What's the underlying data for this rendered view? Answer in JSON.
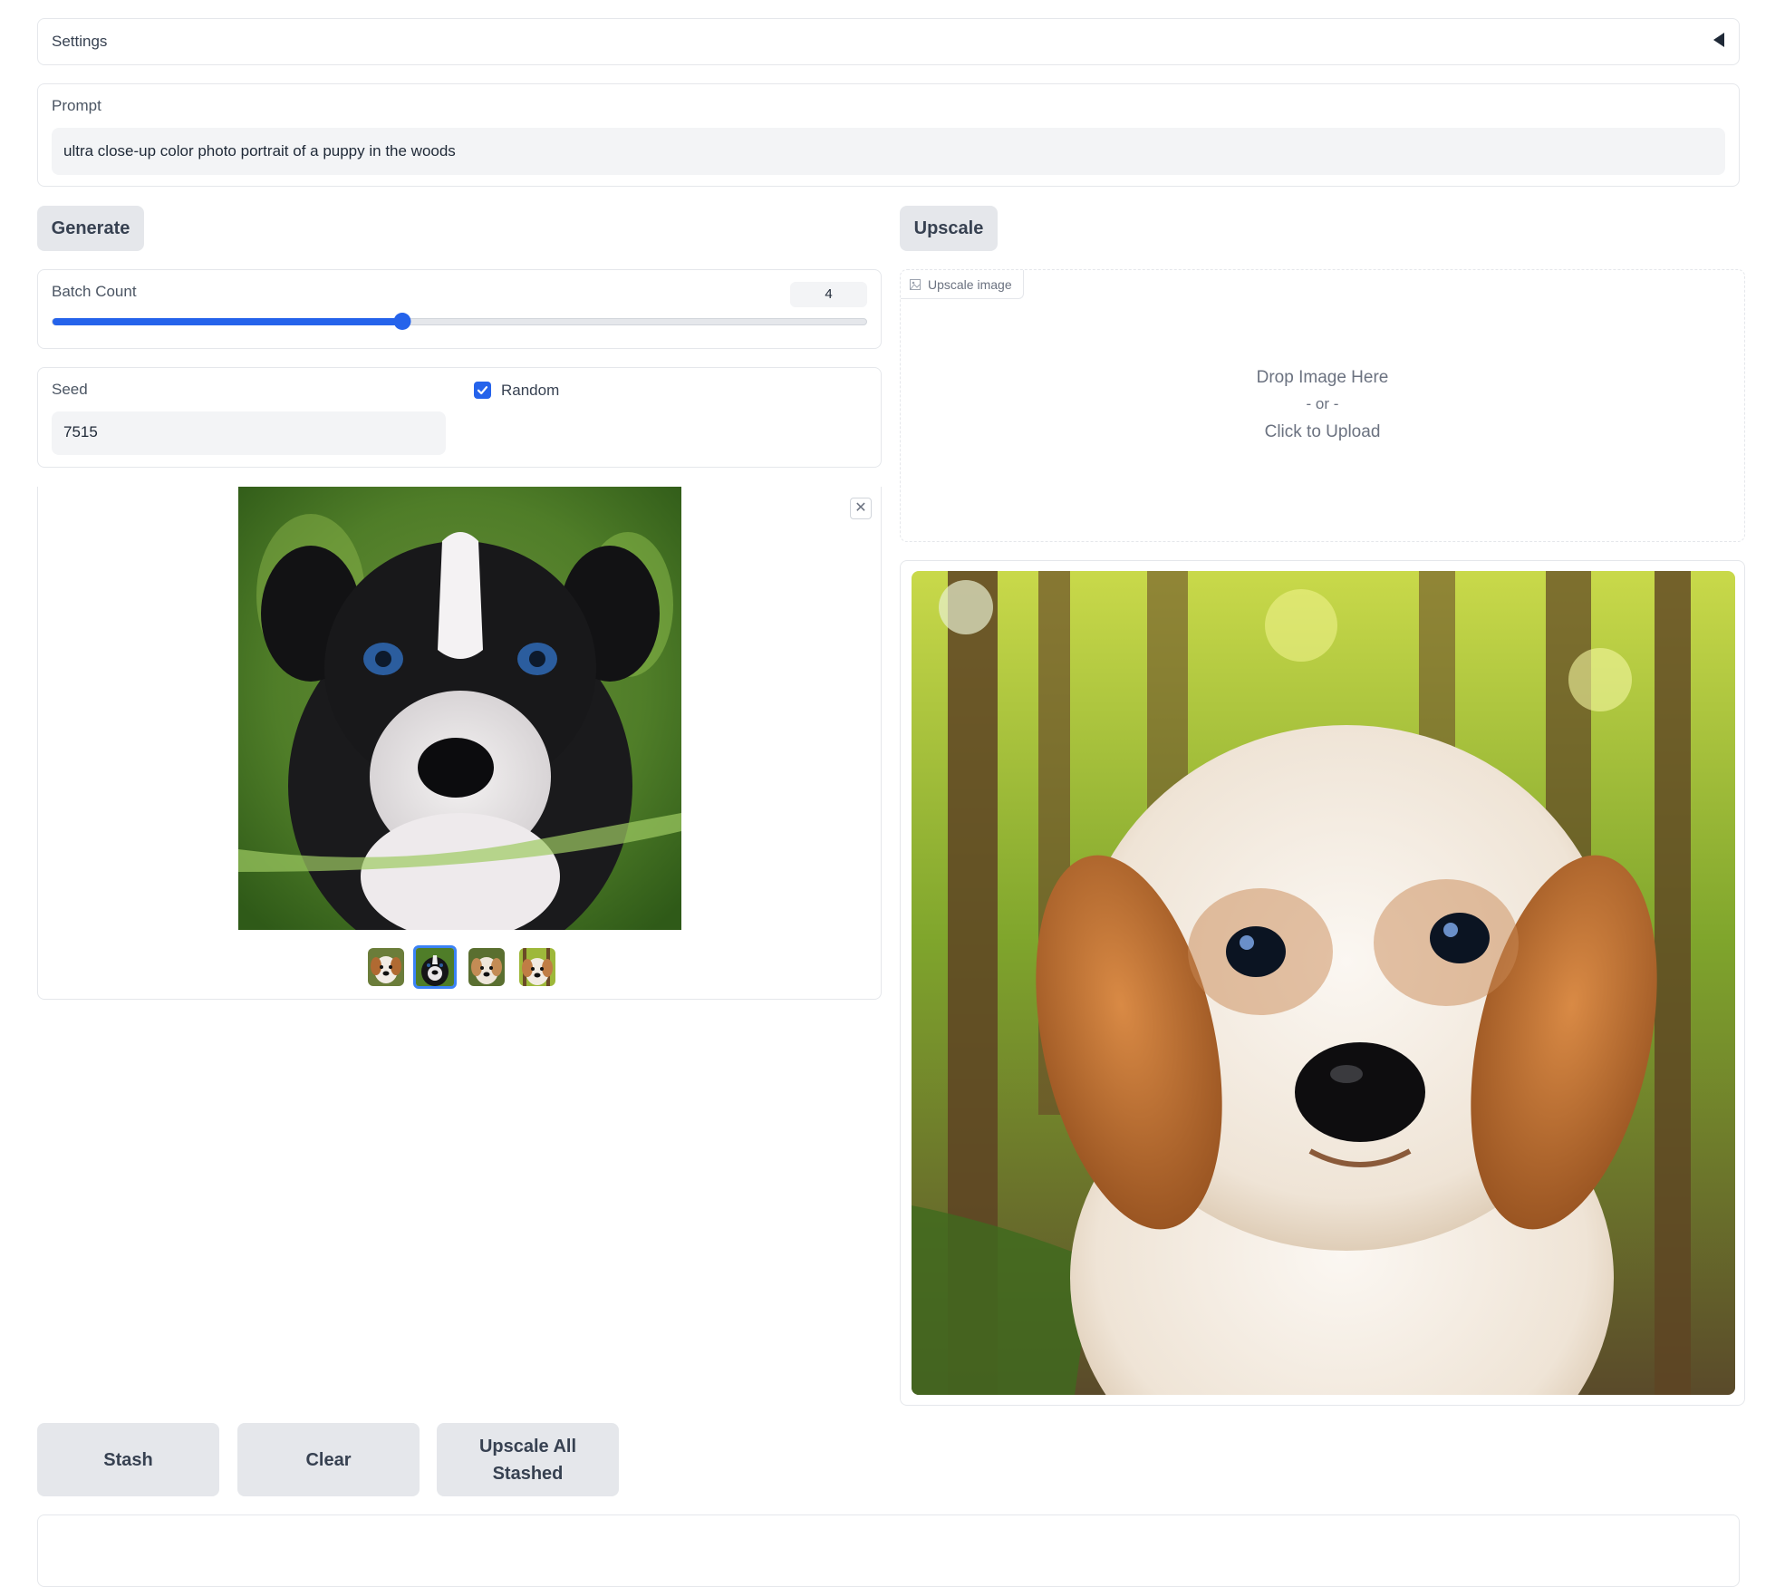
{
  "settings": {
    "label": "Settings"
  },
  "prompt": {
    "label": "Prompt",
    "value": "ultra close-up color photo portrait of a puppy in the woods"
  },
  "buttons": {
    "generate": "Generate",
    "upscale": "Upscale",
    "stash": "Stash",
    "clear": "Clear",
    "upscale_all_stashed": "Upscale All Stashed"
  },
  "batch_count": {
    "label": "Batch Count",
    "value": "4",
    "fraction": 0.43
  },
  "seed": {
    "label": "Seed",
    "value": "7515",
    "random_label": "Random",
    "random_checked": true
  },
  "gallery": {
    "selected_index": 1,
    "thumbnails": [
      "puppy-brown-white",
      "puppy-black-white",
      "puppy-tan",
      "puppy-tan-forest"
    ]
  },
  "upscale_image": {
    "tag": "Upscale image",
    "drop_line1": "Drop Image Here",
    "drop_line2": "- or -",
    "drop_line3": "Click to Upload"
  },
  "colors": {
    "accent": "#2563eb",
    "button_bg": "#e5e7eb"
  }
}
